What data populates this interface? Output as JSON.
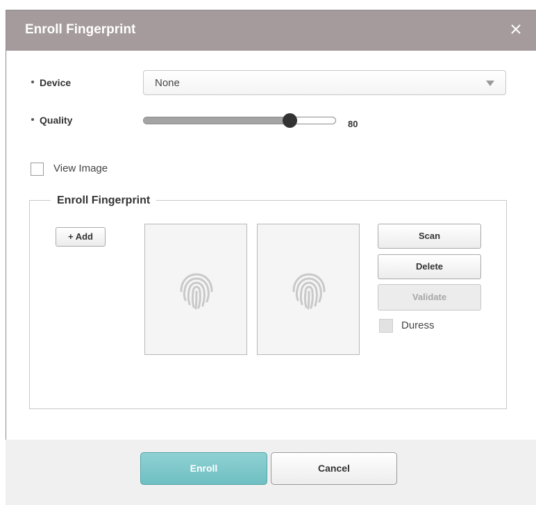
{
  "dialog": {
    "title": "Enroll Fingerprint",
    "close_icon": "close-icon"
  },
  "device": {
    "label": "Device",
    "selected": "None",
    "arrow_icon": "chevron-down-icon"
  },
  "quality": {
    "label": "Quality",
    "value": 80,
    "value_text": "80",
    "fill_fraction": 0.76
  },
  "view_image": {
    "label": "View Image",
    "checked": false
  },
  "enroll_section": {
    "legend": "Enroll Fingerprint",
    "add_label": "+ Add",
    "panels": [
      {
        "icon": "fingerprint-icon"
      },
      {
        "icon": "fingerprint-icon"
      }
    ],
    "scan_label": "Scan",
    "delete_label": "Delete",
    "validate_label": "Validate",
    "validate_disabled": true,
    "duress_label": "Duress",
    "duress_checked": false
  },
  "footer": {
    "enroll_label": "Enroll",
    "cancel_label": "Cancel"
  },
  "colors": {
    "titlebar": "#a59b9c",
    "accent": "#6fbfc2",
    "panel_bg": "#f5f5f5"
  }
}
